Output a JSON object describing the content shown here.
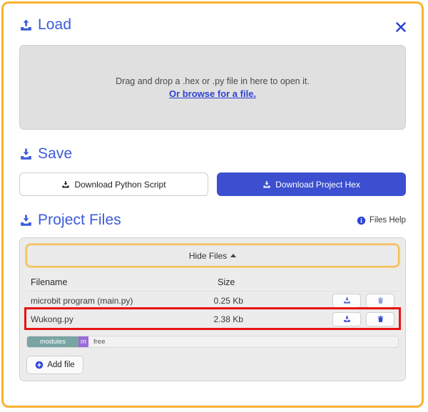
{
  "window": {
    "border_color": "#f9b233",
    "close_label": "✕"
  },
  "load": {
    "title": "Load",
    "icon": "upload-icon",
    "dropzone_text": "Drag and drop a .hex or .py file in here to open it.",
    "browse_link": "Or browse for a file."
  },
  "save": {
    "title": "Save",
    "icon": "download-icon",
    "download_python_label": "Download Python Script",
    "download_hex_label": "Download Project Hex",
    "primary_color": "#3b4fd0"
  },
  "project_files": {
    "title": "Project Files",
    "icon": "download-icon",
    "files_help_label": "Files Help",
    "hide_files_label": "Hide Files",
    "columns": {
      "filename": "Filename",
      "size": "Size"
    },
    "rows": [
      {
        "filename": "microbit program (main.py)",
        "size": "0.25 Kb",
        "highlighted": false
      },
      {
        "filename": "Wukong.py",
        "size": "2.38 Kb",
        "highlighted": true
      }
    ],
    "storage": {
      "modules_label": "modules",
      "main_label": "m",
      "free_label": "free",
      "modules_color": "#78a5a3",
      "main_color": "#9b6cd6"
    },
    "add_file_label": "Add file",
    "highlight_color": "#e81313",
    "focus_color": "#f2b736"
  }
}
